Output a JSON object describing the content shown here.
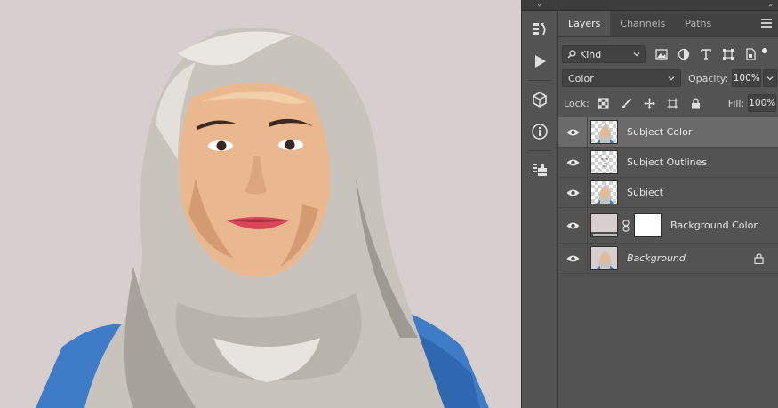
{
  "colors": {
    "canvas_bg": "#d6cfcd",
    "panel_bg": "#535353",
    "tab_strip_bg": "#424242",
    "selected_layer_bg": "#6a6a6a"
  },
  "toolstrip": {
    "collapse_glyph": "«",
    "tools": [
      "history-brush-icon",
      "play-icon",
      "3d-cube-icon",
      "info-icon",
      "clone-source-icon"
    ]
  },
  "panel": {
    "expand_glyph": "»",
    "tabs": [
      {
        "label": "Layers",
        "active": true
      },
      {
        "label": "Channels",
        "active": false
      },
      {
        "label": "Paths",
        "active": false
      }
    ],
    "filter": {
      "kind_label": "Kind",
      "icons": [
        "image-filter-icon",
        "adjustment-filter-icon",
        "type-filter-icon",
        "shape-filter-icon",
        "smart-object-filter-icon"
      ]
    },
    "blend_mode": "Color",
    "opacity_label": "Opacity:",
    "opacity_value": "100%",
    "lock_label": "Lock:",
    "lock_icons": [
      "lock-transparent-icon",
      "lock-image-icon",
      "lock-position-icon",
      "lock-artboard-icon",
      "lock-all-icon"
    ],
    "fill_label": "Fill:",
    "fill_value": "100%",
    "layers": [
      {
        "name": "Subject Color",
        "selected": true,
        "visible": true,
        "thumb": "photo"
      },
      {
        "name": "Subject Outlines",
        "selected": false,
        "visible": true,
        "thumb": "outlines"
      },
      {
        "name": "Subject",
        "selected": false,
        "visible": true,
        "thumb": "photo"
      },
      {
        "name": "Background Color",
        "selected": false,
        "visible": true,
        "thumb": "fill-with-mask"
      },
      {
        "name": "Background",
        "selected": false,
        "visible": true,
        "thumb": "photo",
        "locked": true,
        "italic": true
      }
    ]
  }
}
